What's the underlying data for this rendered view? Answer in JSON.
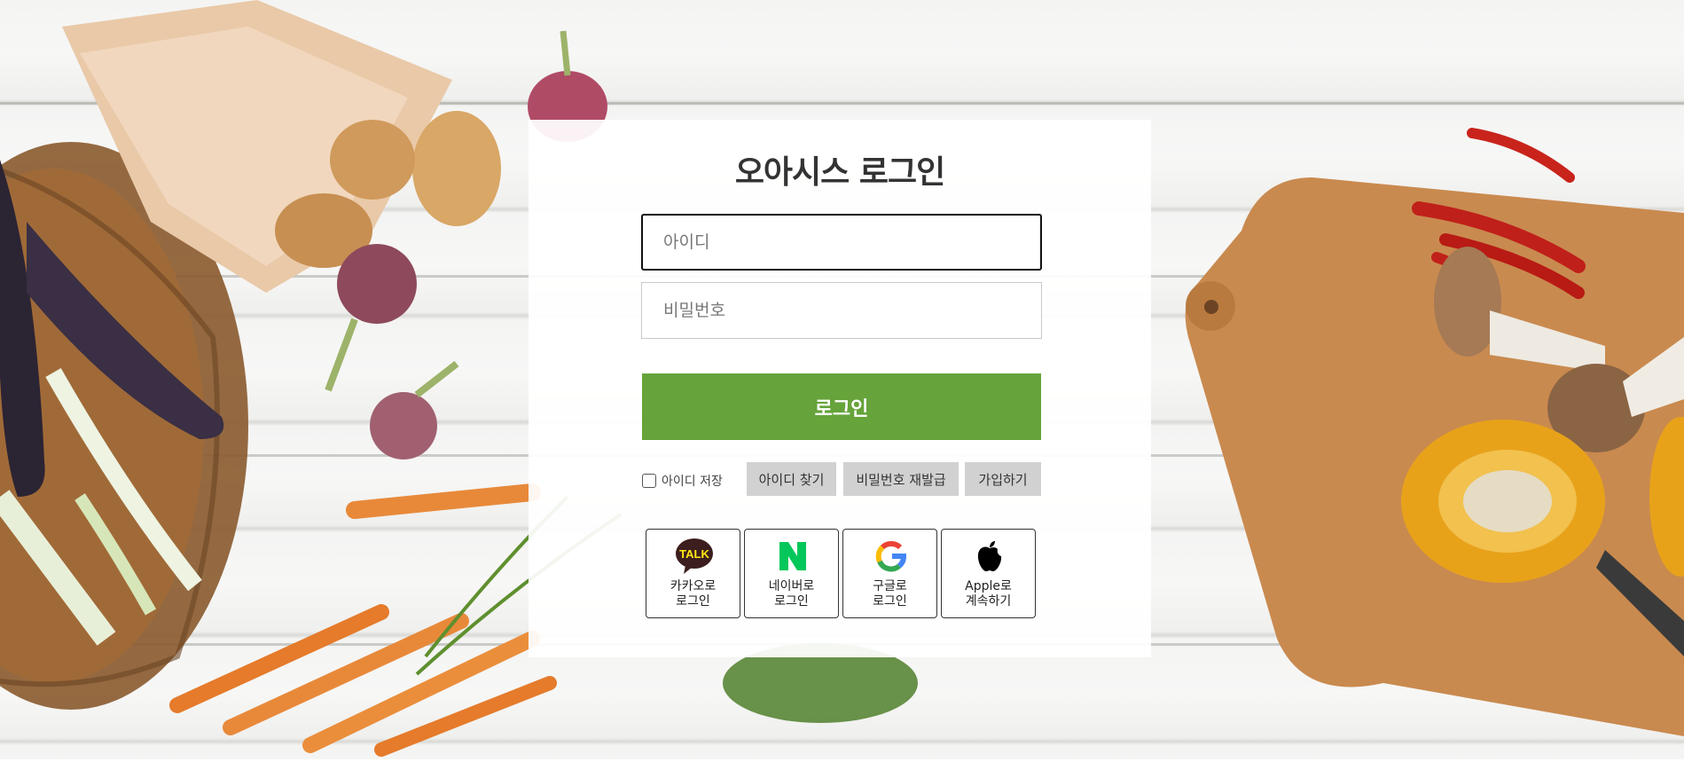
{
  "login": {
    "title": "오아시스 로그인",
    "id_placeholder": "아이디",
    "password_placeholder": "비밀번호",
    "login_button": "로그인",
    "save_id_label": "아이디 저장",
    "find_id": "아이디 찾기",
    "reset_password": "비밀번호 재발급",
    "signup": "가입하기"
  },
  "social": [
    {
      "label": "카카오로\n로그인",
      "icon": "kakao-talk-icon"
    },
    {
      "label": "네이버로\n로그인",
      "icon": "naver-icon"
    },
    {
      "label": "구글로\n로그인",
      "icon": "google-icon"
    },
    {
      "label": "Apple로\n계속하기",
      "icon": "apple-icon"
    }
  ],
  "colors": {
    "accent_green": "#66a33a",
    "link_button_bg": "#d1d1d1",
    "kakao_yellow": "#ffe812",
    "naver_green": "#03c75a"
  }
}
